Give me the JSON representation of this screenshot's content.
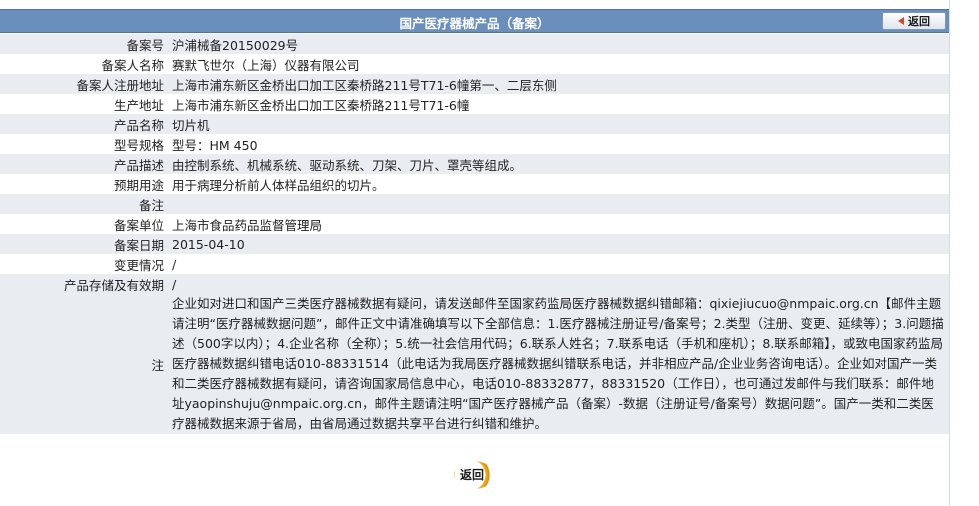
{
  "header": {
    "title": "国产医疗器械产品（备案）",
    "back_label": "返回"
  },
  "rows": [
    {
      "label": "备案号",
      "value": "沪浦械备20150029号"
    },
    {
      "label": "备案人名称",
      "value": "赛默飞世尔（上海）仪器有限公司"
    },
    {
      "label": "备案人注册地址",
      "value": "上海市浦东新区金桥出口加工区秦桥路211号T71-6幢第一、二层东侧"
    },
    {
      "label": "生产地址",
      "value": "上海市浦东新区金桥出口加工区秦桥路211号T71-6幢"
    },
    {
      "label": "产品名称",
      "value": "切片机"
    },
    {
      "label": "型号规格",
      "value": "型号：HM 450"
    },
    {
      "label": "产品描述",
      "value": "由控制系统、机械系统、驱动系统、刀架、刀片、罩壳等组成。"
    },
    {
      "label": "预期用途",
      "value": "用于病理分析前人体样品组织的切片。"
    },
    {
      "label": "备注",
      "value": ""
    },
    {
      "label": "备案单位",
      "value": "上海市食品药品监督管理局"
    },
    {
      "label": "备案日期",
      "value": "2015-04-10"
    },
    {
      "label": "变更情况",
      "value": "/"
    },
    {
      "label": "产品存储及有效期",
      "value": "/"
    }
  ],
  "note": {
    "label": "注",
    "text": "企业如对进口和国产三类医疗器械数据有疑问，请发送邮件至国家药监局医疗器械数据纠错邮箱：qixiejiucuo@nmpaic.org.cn【邮件主题请注明“医疗器械数据问题”，邮件正文中请准确填写以下全部信息：1.医疗器械注册证号/备案号；2.类型（注册、变更、延续等）；3.问题描述（500字以内）；4.企业名称（全称）；5.统一社会信用代码；6.联系人姓名；7.联系电话（手机和座机）；8.联系邮箱】，或致电国家药监局医疗器械数据纠错电话010-88331514（此电话为我局医疗器械数据纠错联系电话，并非相应产品/企业业务咨询电话）。企业如对国产一类和二类医疗器械数据有疑问，请咨询国家局信息中心，电话010-88332877，88331520（工作日），也可通过发邮件与我们联系：邮件地址yaopinshuju@nmpaic.org.cn，邮件主题请注明“国产医疗器械产品（备案）-数据（注册证号/备案号）数据问题”。国产一类和二类医疗器械数据来源于省局，由省局通过数据共享平台进行纠错和维护。"
  },
  "footer": {
    "back_label": "返回"
  },
  "colors": {
    "header_bg": "#6a8fbd",
    "row_alt_bg": "#e9edf2",
    "accent_orange": "#f5b51f"
  }
}
